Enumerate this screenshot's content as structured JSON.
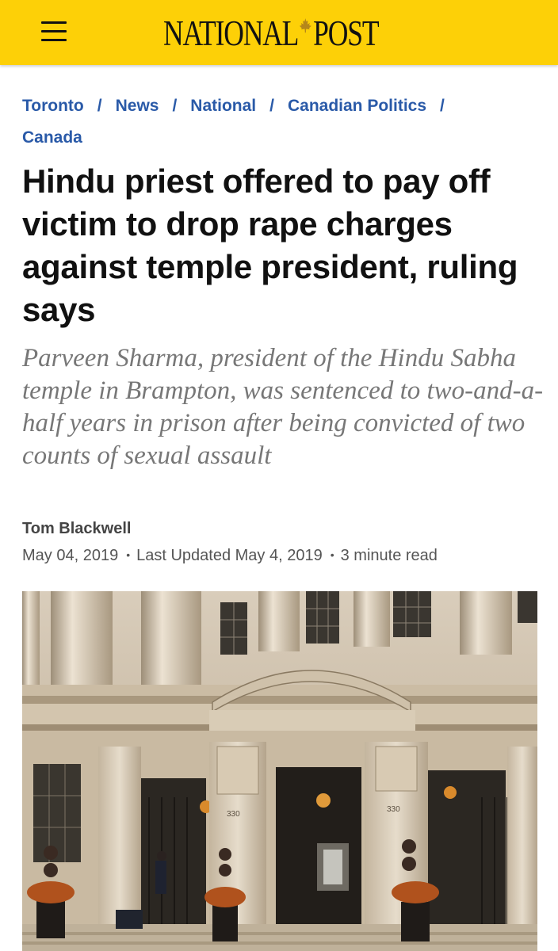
{
  "header": {
    "menu_icon": "hamburger-menu-icon",
    "logo_left": "NATIONAL",
    "logo_right": "POST",
    "logo_icon": "maple-leaf-icon",
    "background_color": "#fdd007"
  },
  "breadcrumb": {
    "items": [
      {
        "label": "Toronto"
      },
      {
        "label": "News"
      },
      {
        "label": "National"
      },
      {
        "label": "Canadian Politics"
      },
      {
        "label": "Canada"
      }
    ],
    "separator": "/",
    "link_color": "#2a5aa8"
  },
  "article": {
    "headline": "Hindu priest offered to pay off victim to drop rape charges against temple president, ruling says",
    "dek": "Parveen Sharma, president of the Hindu Sabha temple in Brampton, was sentenced to two-and-a-half years in prison after being convicted of two counts of sexual assault",
    "author": "Tom Blackwell",
    "published": "May 04, 2019",
    "updated": "Last Updated May 4, 2019",
    "read_time": "3 minute read",
    "dot": "•",
    "hero_labels": {
      "number_left": "330",
      "number_right": "330"
    }
  }
}
